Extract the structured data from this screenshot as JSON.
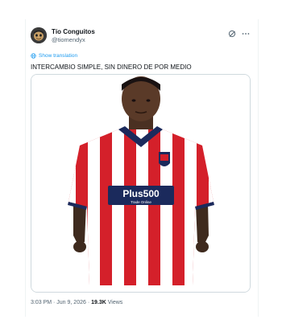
{
  "tweet": {
    "author": {
      "display_name": "Tío Conguitos",
      "handle": "@tiomendyx",
      "avatar_icon": "avatar-image"
    },
    "actions": {
      "grok_icon": "grok-icon",
      "more_icon": "more-icon"
    },
    "translate_label": "Show translation",
    "text": "INTERCAMBIO SIMPLE, SIN DINERO DE POR MEDIO",
    "media": {
      "sponsor_main": "Plus500",
      "sponsor_sub": "Trade Online"
    },
    "meta": {
      "timestamp": "3:03 PM · Jun 9, 2026 · ",
      "views_count": "19.3K",
      "views_label": " Views"
    }
  },
  "colors": {
    "link_blue": "#1d9bf0",
    "text_primary": "#0f1419",
    "text_secondary": "#536471",
    "kit_red": "#d4202a",
    "kit_navy": "#1b2a5c"
  }
}
